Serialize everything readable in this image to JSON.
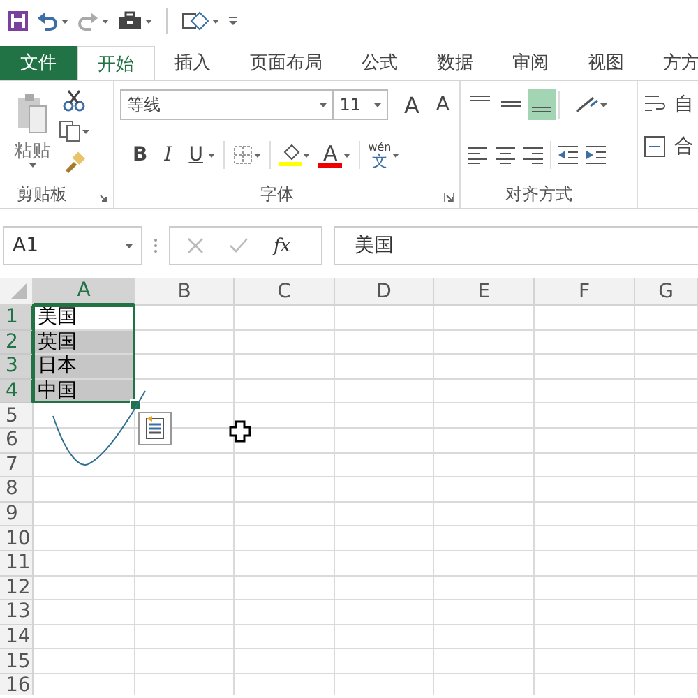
{
  "tabs": [
    {
      "label": "文件",
      "kind": "file",
      "selected": false
    },
    {
      "label": "开始",
      "kind": "tab",
      "selected": true
    },
    {
      "label": "插入",
      "kind": "tab",
      "selected": false
    },
    {
      "label": "页面布局",
      "kind": "tab",
      "selected": false
    },
    {
      "label": "公式",
      "kind": "tab",
      "selected": false
    },
    {
      "label": "数据",
      "kind": "tab",
      "selected": false
    },
    {
      "label": "审阅",
      "kind": "tab",
      "selected": false
    },
    {
      "label": "视图",
      "kind": "tab",
      "selected": false
    },
    {
      "label": "方方",
      "kind": "tab",
      "selected": false
    }
  ],
  "ribbon": {
    "clipboard": {
      "paste_label": "粘贴",
      "group_label": "剪贴板"
    },
    "font": {
      "name": "等线",
      "size": "11",
      "grow": "A",
      "shrink": "A",
      "bold": "B",
      "italic": "I",
      "underline": "U",
      "font_color": "A",
      "phonetic_top": "wén",
      "phonetic_bottom": "文",
      "group_label": "字体"
    },
    "alignment": {
      "buttons": [
        {
          "kind": "top",
          "selected": false
        },
        {
          "kind": "middle",
          "selected": false
        },
        {
          "kind": "bottom",
          "selected": true
        }
      ],
      "group_label": "对齐方式"
    },
    "wrap_text": "自",
    "merge": "合"
  },
  "formula_bar": {
    "name_box": "A1",
    "fx": "fx",
    "formula": "美国"
  },
  "grid": {
    "columns": [
      {
        "label": "A",
        "selected": true
      },
      {
        "label": "B",
        "selected": false
      },
      {
        "label": "C",
        "selected": false
      },
      {
        "label": "D",
        "selected": false
      },
      {
        "label": "E",
        "selected": false
      },
      {
        "label": "F",
        "selected": false
      },
      {
        "label": "G",
        "selected": false
      }
    ],
    "rows": [
      {
        "label": "1",
        "selected": true,
        "cells": [
          {
            "text": "美国",
            "active": true,
            "selected": true
          }
        ]
      },
      {
        "label": "2",
        "selected": true,
        "cells": [
          {
            "text": "英国",
            "active": false,
            "selected": true
          }
        ]
      },
      {
        "label": "3",
        "selected": true,
        "cells": [
          {
            "text": "日本",
            "active": false,
            "selected": true
          }
        ]
      },
      {
        "label": "4",
        "selected": true,
        "cells": [
          {
            "text": "中国",
            "active": false,
            "selected": true
          }
        ]
      },
      {
        "label": "5",
        "selected": false
      },
      {
        "label": "6",
        "selected": false
      },
      {
        "label": "7",
        "selected": false
      },
      {
        "label": "8",
        "selected": false
      },
      {
        "label": "9",
        "selected": false
      },
      {
        "label": "10",
        "selected": false
      },
      {
        "label": "11",
        "selected": false
      },
      {
        "label": "12",
        "selected": false
      },
      {
        "label": "13",
        "selected": false
      },
      {
        "label": "14",
        "selected": false
      },
      {
        "label": "15",
        "selected": false
      },
      {
        "label": "16",
        "selected": false
      }
    ]
  }
}
